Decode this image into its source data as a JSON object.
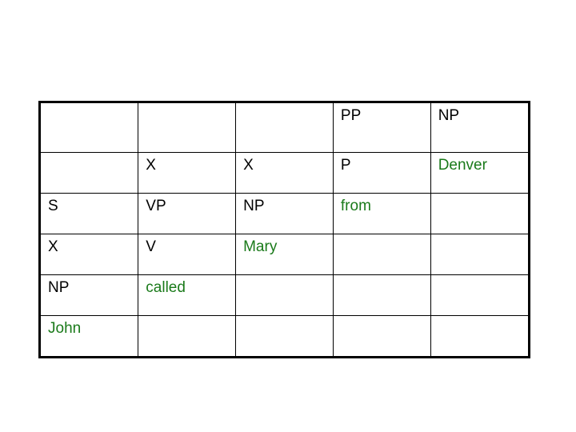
{
  "colors": {
    "nonterminal": "#000000",
    "terminal": "#1a7a1a",
    "border": "#000000",
    "background": "#ffffff"
  },
  "chart_data": {
    "type": "table",
    "title": "",
    "columns": 5,
    "rows": 6,
    "grid": [
      [
        "",
        "",
        "",
        "PP",
        "NP"
      ],
      [
        "",
        "X",
        "X",
        "P",
        "Denver"
      ],
      [
        "S",
        "VP",
        "NP",
        "from",
        ""
      ],
      [
        "X",
        "V",
        "Mary",
        "",
        ""
      ],
      [
        "NP",
        "called",
        "",
        "",
        ""
      ],
      [
        "John",
        "",
        "",
        "",
        ""
      ]
    ],
    "cell_kinds": [
      [
        "empty",
        "empty",
        "empty",
        "nonterminal",
        "nonterminal"
      ],
      [
        "empty",
        "nonterminal",
        "nonterminal",
        "nonterminal",
        "terminal"
      ],
      [
        "nonterminal",
        "nonterminal",
        "nonterminal",
        "terminal",
        "empty"
      ],
      [
        "nonterminal",
        "nonterminal",
        "terminal",
        "empty",
        "empty"
      ],
      [
        "nonterminal",
        "terminal",
        "empty",
        "empty",
        "empty"
      ],
      [
        "terminal",
        "empty",
        "empty",
        "empty",
        "empty"
      ]
    ]
  }
}
